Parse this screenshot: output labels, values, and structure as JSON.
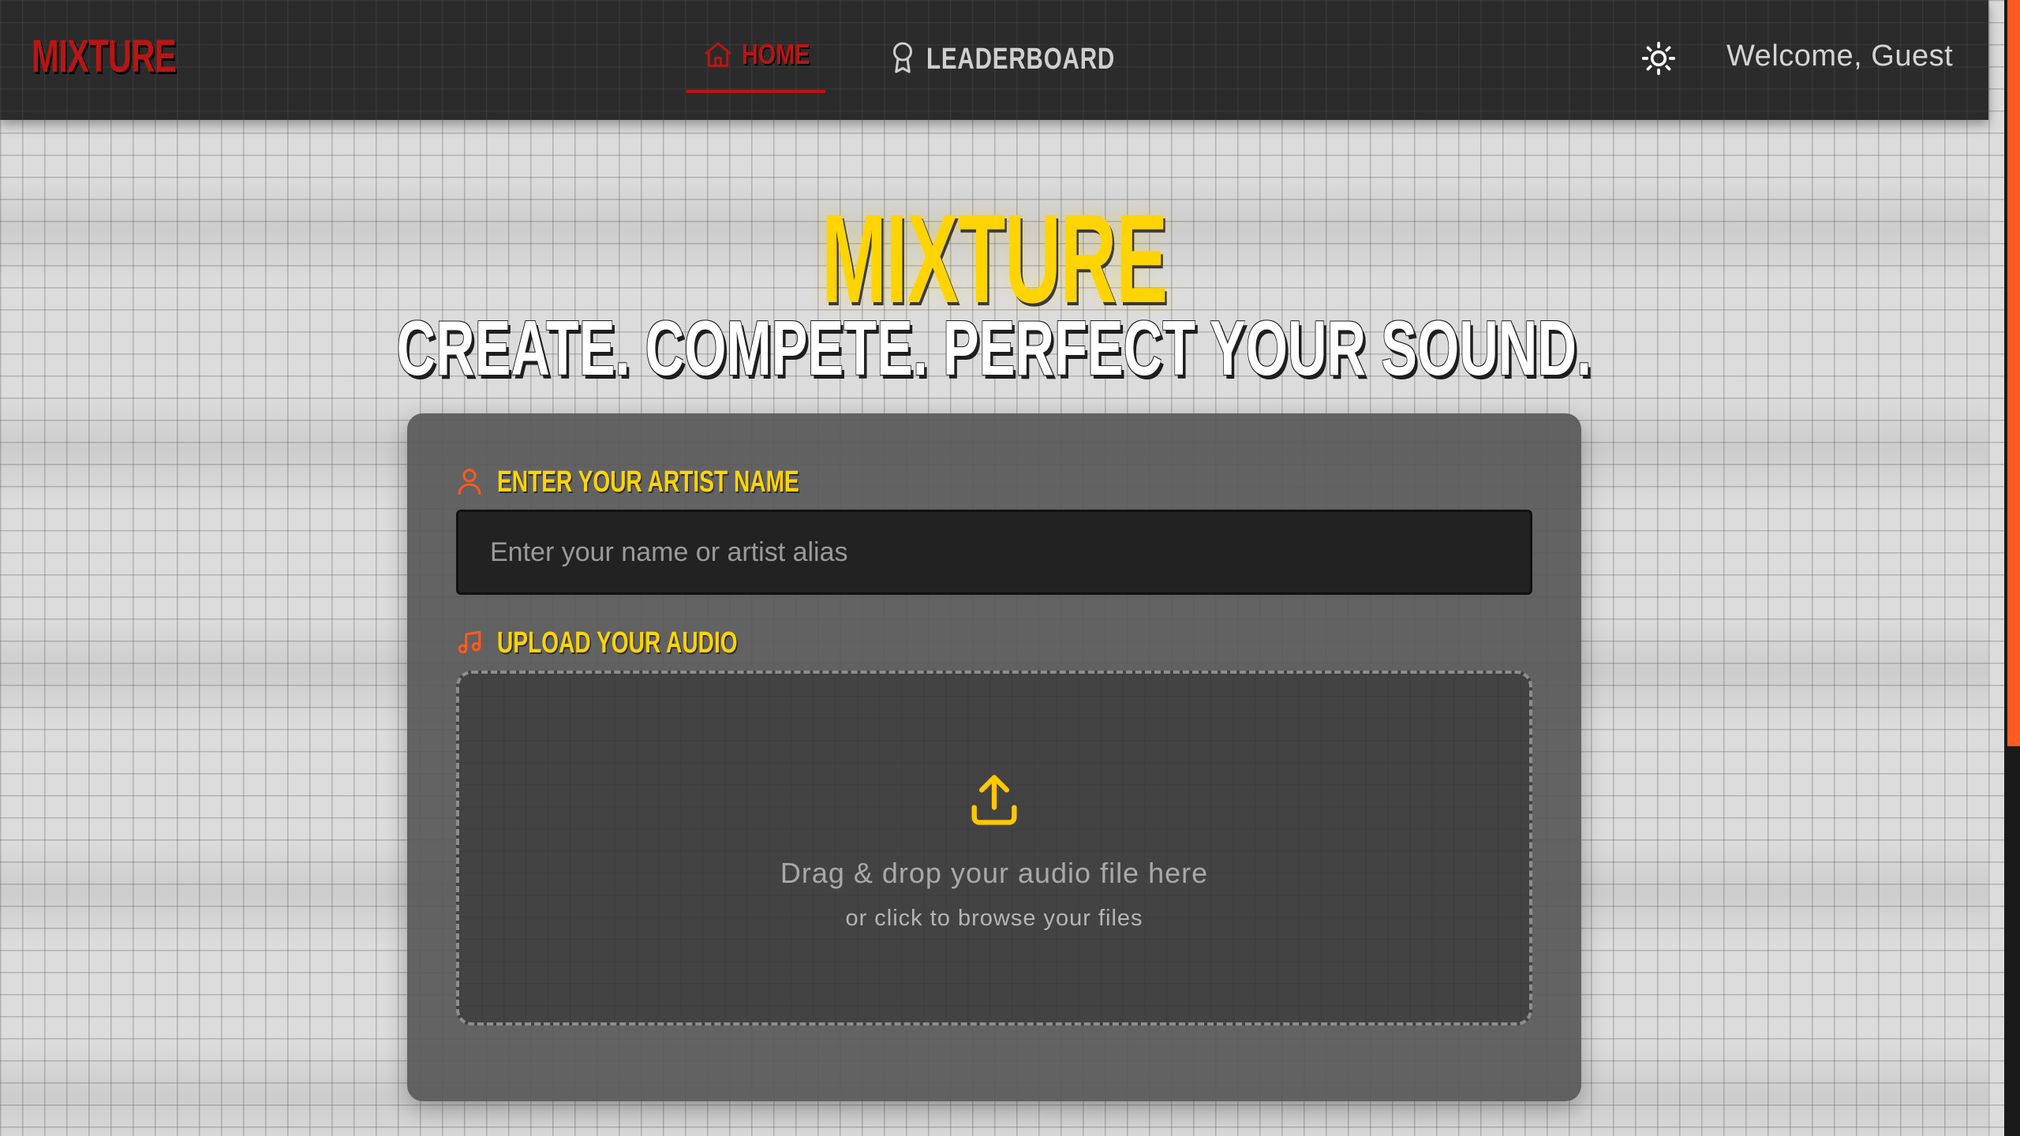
{
  "nav": {
    "brand": "MIXTURE",
    "home_label": "HOME",
    "leaderboard_label": "LEADERBOARD",
    "welcome_text": "Welcome, Guest",
    "active_color": "#b91515"
  },
  "hero": {
    "title": "MIXTURE",
    "subtitle": "CREATE. COMPETE. PERFECT YOUR SOUND.",
    "title_color": "#ffd400"
  },
  "form": {
    "artist_label": "ENTER YOUR ARTIST NAME",
    "artist_placeholder": "Enter your name or artist alias",
    "artist_value": "",
    "upload_label": "UPLOAD YOUR AUDIO",
    "drop_main": "Drag & drop your audio file here",
    "drop_sub": "or click to browse your files",
    "icon_color": "#ff5a1f"
  },
  "icons": {
    "home": "home-icon",
    "leaderboard": "award-icon",
    "theme": "sun-icon",
    "artist": "user-icon",
    "audio": "music-note-icon",
    "upload": "upload-icon"
  },
  "scrollbar": {
    "color": "#ff5a1f"
  }
}
